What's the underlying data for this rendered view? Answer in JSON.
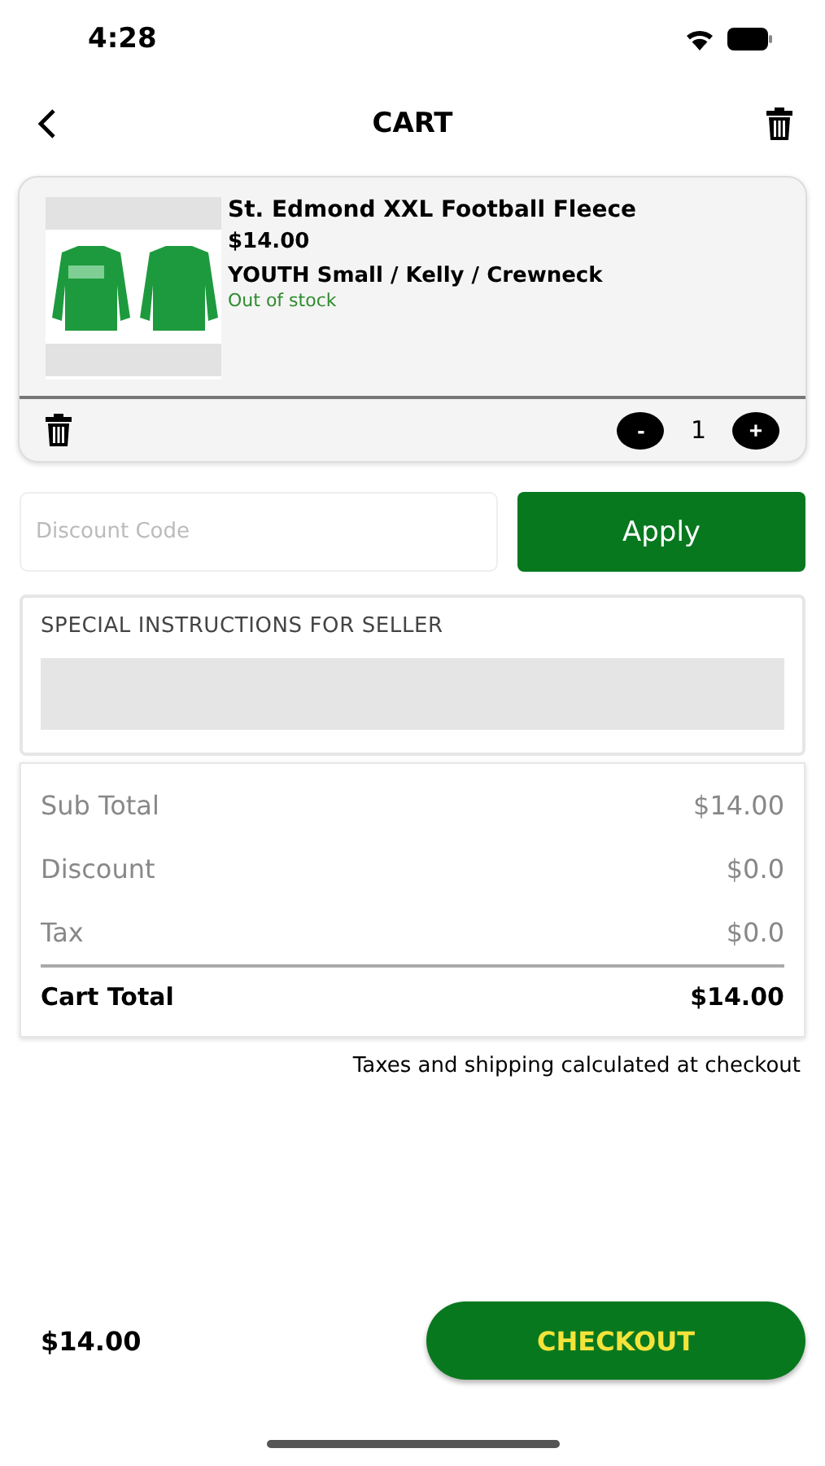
{
  "status_bar": {
    "time": "4:28"
  },
  "header": {
    "title": "CART"
  },
  "cart_items": [
    {
      "kind": "picture",
      "name": "St. Edmond XXL Football Fleece",
      "price": "$14.00",
      "variant": "YOUTH Small / Kelly / Crewneck",
      "stock": "Out of stock",
      "decrement": "-",
      "quantity": "1",
      "increment": "+"
    }
  ],
  "discount": {
    "placeholder": "Discount Code",
    "button": "Apply"
  },
  "instructions": {
    "label": "SPECIAL INSTRUCTIONS FOR SELLER"
  },
  "summary": [
    {
      "kind": "line",
      "label": "Sub Total",
      "value": "$14.00"
    },
    {
      "kind": "line",
      "label": "Discount",
      "value": "$0.0"
    },
    {
      "kind": "line",
      "label": "Tax",
      "value": "$0.0"
    },
    {
      "kind": "total",
      "label": "Cart Total",
      "value": "$14.00"
    }
  ],
  "note": "Taxes and shipping calculated at checkout",
  "footer": {
    "total": "$14.00",
    "checkout": "CHECKOUT"
  }
}
